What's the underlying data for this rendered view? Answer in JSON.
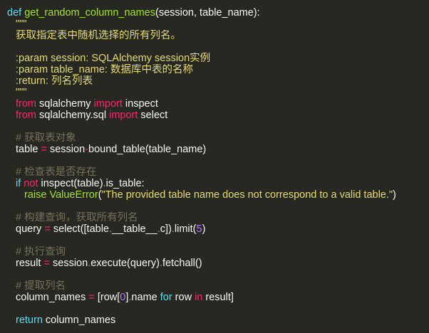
{
  "code": {
    "l1": {
      "kw": "def",
      "fn": "get_random_column_names",
      "args": "(session, table_name):"
    },
    "l2": "\"\"\"",
    "l3": "获取指定表中随机选择的所有列名。",
    "l4": "",
    "l5": ":param session: SQLAlchemy session实例",
    "l6": ":param table_name: 数据库中表的名称",
    "l7": ":return: 列名列表",
    "l8": "\"\"\"",
    "l9": {
      "kw": "from",
      "mod": "sqlalchemy",
      "imp": "import",
      "name": "inspect"
    },
    "l10": {
      "kw": "from",
      "mod": "sqlalchemy.sql",
      "imp": "import",
      "name": "select"
    },
    "l11": "",
    "l12": "# 获取表对象",
    "l13": {
      "a": "table",
      "op": "=",
      "b": "session",
      "op2": "-",
      "c": "bound_table(table_name)"
    },
    "l14": "",
    "l15": "# 检查表是否存在",
    "l16": {
      "kw": "if",
      "not": "not",
      "a": "inspect(table)",
      "dot": ".",
      "b": "is_table:"
    },
    "l17": {
      "raise": "raise",
      "cls": "ValueError",
      "p1": "(",
      "str": "\"The provided table name does not correspond to a valid table.\"",
      "p2": ")"
    },
    "l18": "",
    "l19": "# 构建查询，获取所有列名",
    "l20": {
      "a": "query",
      "op": "=",
      "b": "select([table",
      "dot1": ".",
      "c": "__table__",
      "dot2": ".",
      "d": "c])",
      "dot3": ".",
      "e": "limit(",
      "num": "5",
      "f": ")"
    },
    "l21": "",
    "l22": "# 执行查询",
    "l23": {
      "a": "result",
      "op": "=",
      "b": "session",
      "dot1": ".",
      "c": "execute(query)",
      "dot2": ".",
      "d": "fetchall()"
    },
    "l24": "",
    "l25": "# 提取列名",
    "l26": {
      "a": "column_names",
      "op": "=",
      "b": "[row[",
      "num": "0",
      "c": "]",
      "dot": ".",
      "d": "name ",
      "kw": "for",
      "e": " row ",
      "in": "in",
      "f": " result]"
    },
    "l27": "",
    "l28": {
      "kw": "return",
      "a": "column_names"
    }
  }
}
